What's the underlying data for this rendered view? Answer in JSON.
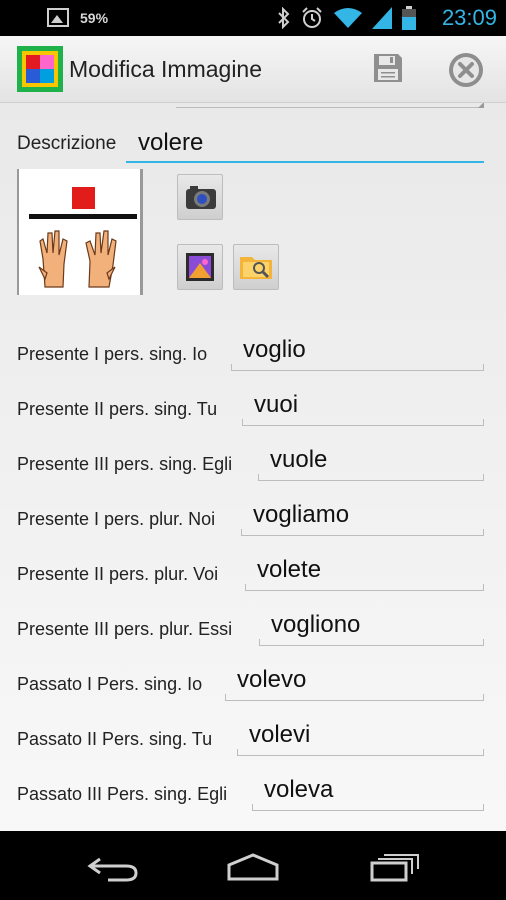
{
  "status_bar": {
    "battery_text": "59%",
    "time": "23:09",
    "time_color": "#33b5e5",
    "icons": [
      "image-icon",
      "bluetooth-icon",
      "alarm-icon",
      "wifi-icon",
      "signal-icon",
      "battery-icon"
    ]
  },
  "action_bar": {
    "title": "Modifica Immagine",
    "icons": [
      "app-icon",
      "save-icon",
      "close-icon"
    ]
  },
  "description": {
    "label": "Descrizione",
    "value": "volere",
    "accent": "#33b5e5"
  },
  "image_buttons": [
    "camera-icon",
    "gallery-icon",
    "folder-search-icon"
  ],
  "conjugations": [
    {
      "label": "Presente I pers. sing. Io",
      "value": "voglio"
    },
    {
      "label": "Presente II pers. sing. Tu",
      "value": "vuoi"
    },
    {
      "label": "Presente III pers. sing. Egli",
      "value": "vuole"
    },
    {
      "label": "Presente I pers. plur. Noi",
      "value": "vogliamo"
    },
    {
      "label": "Presente II pers. plur. Voi",
      "value": "volete"
    },
    {
      "label": "Presente III pers. plur. Essi",
      "value": "vogliono"
    },
    {
      "label": "Passato I Pers. sing. Io",
      "value": "volevo"
    },
    {
      "label": "Passato II Pers. sing. Tu",
      "value": "volevi"
    },
    {
      "label": "Passato III Pers. sing. Egli",
      "value": "voleva"
    }
  ],
  "nav_bar": {
    "buttons": [
      "back-icon",
      "home-icon",
      "recent-apps-icon"
    ]
  }
}
